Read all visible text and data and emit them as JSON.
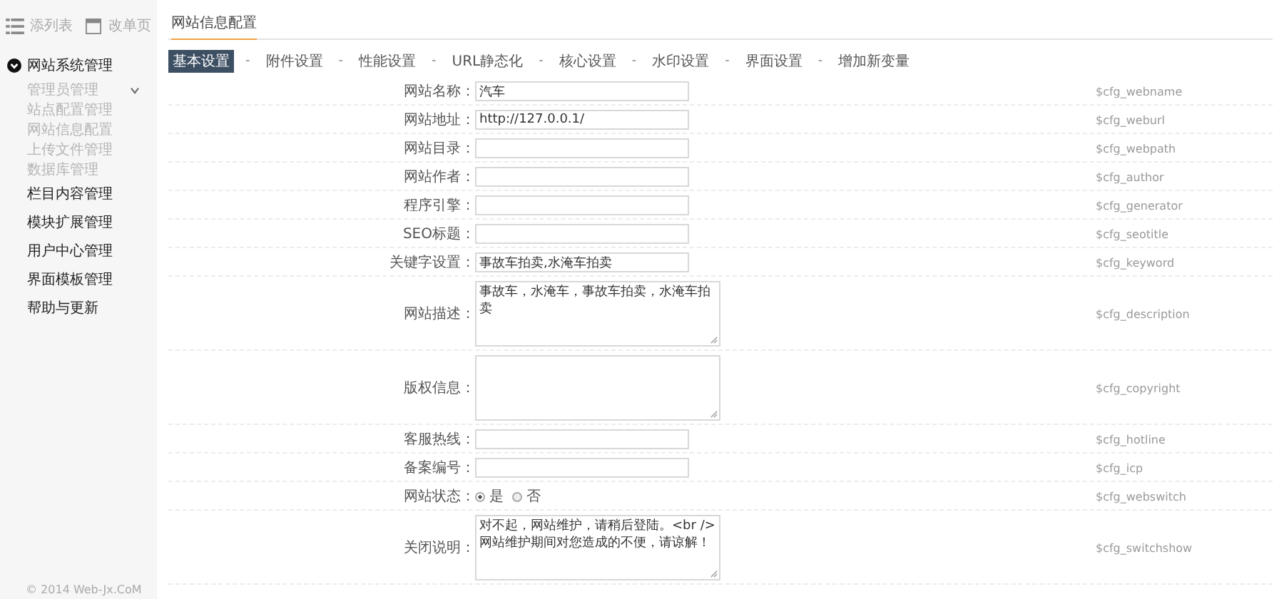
{
  "toolbar": [
    {
      "label": "添列表",
      "kind": "list"
    },
    {
      "label": "改单页",
      "kind": "page"
    }
  ],
  "sidebar": {
    "groups": [
      {
        "label": "网站系统管理",
        "expanded": true,
        "children": [
          {
            "label": "管理员管理",
            "has_submenu": true
          },
          {
            "label": "站点配置管理",
            "has_submenu": false
          },
          {
            "label": "网站信息配置",
            "has_submenu": false
          },
          {
            "label": "上传文件管理",
            "has_submenu": false
          },
          {
            "label": "数据库管理",
            "has_submenu": false
          }
        ]
      },
      {
        "label": "栏目内容管理",
        "expanded": false
      },
      {
        "label": "模块扩展管理",
        "expanded": false
      },
      {
        "label": "用户中心管理",
        "expanded": false
      },
      {
        "label": "界面模板管理",
        "expanded": false
      },
      {
        "label": "帮助与更新",
        "expanded": false
      }
    ],
    "footer": "© 2014 Web-Jx.CoM"
  },
  "page_title": "网站信息配置",
  "tabs": [
    {
      "label": "基本设置",
      "selected": true
    },
    {
      "separator": "-",
      "label": "附件设置",
      "selected": false
    },
    {
      "separator": "-",
      "label": "性能设置",
      "selected": false
    },
    {
      "separator": "-",
      "label": "URL静态化",
      "selected": false
    },
    {
      "separator": "-",
      "label": "核心设置",
      "selected": false
    },
    {
      "separator": "-",
      "label": "水印设置",
      "selected": false
    },
    {
      "separator": "-",
      "label": "界面设置",
      "selected": false
    },
    {
      "separator": "-",
      "label": "增加新变量",
      "selected": false
    }
  ],
  "fields": [
    {
      "kind": "input",
      "label": "网站名称：",
      "value": "汽车",
      "variable": "$cfg_webname"
    },
    {
      "kind": "input",
      "label": "网站地址：",
      "value": "http://127.0.0.1/",
      "variable": "$cfg_weburl"
    },
    {
      "kind": "input",
      "label": "网站目录：",
      "variable": "$cfg_webpath"
    },
    {
      "kind": "input",
      "label": "网站作者：",
      "variable": "$cfg_author"
    },
    {
      "kind": "input",
      "label": "程序引擎：",
      "variable": "$cfg_generator"
    },
    {
      "kind": "input",
      "label": "SEO标题：",
      "variable": "$cfg_seotitle"
    },
    {
      "kind": "input",
      "label": "关键字设置：",
      "value": "事故车拍卖,水淹车拍卖",
      "variable": "$cfg_keyword"
    },
    {
      "kind": "textarea",
      "label": "网站描述：",
      "value": "事故车，水淹车，事故车拍卖，水淹车拍卖",
      "variable": "$cfg_description"
    },
    {
      "kind": "textarea",
      "label": "版权信息：",
      "variable": "$cfg_copyright"
    },
    {
      "kind": "input",
      "label": "客服热线：",
      "variable": "$cfg_hotline"
    },
    {
      "kind": "input",
      "label": "备案编号：",
      "variable": "$cfg_icp"
    },
    {
      "kind": "radio",
      "label": "网站状态：",
      "options": [
        {
          "label": "是",
          "selected": true
        },
        {
          "label": "否",
          "selected": false
        }
      ],
      "variable": "$cfg_webswitch"
    },
    {
      "kind": "textarea",
      "label": "关闭说明：",
      "value": "对不起，网站维护，请稍后登陆。<br />网站维护期间对您造成的不便，请谅解！",
      "variable": "$cfg_switchshow"
    }
  ]
}
